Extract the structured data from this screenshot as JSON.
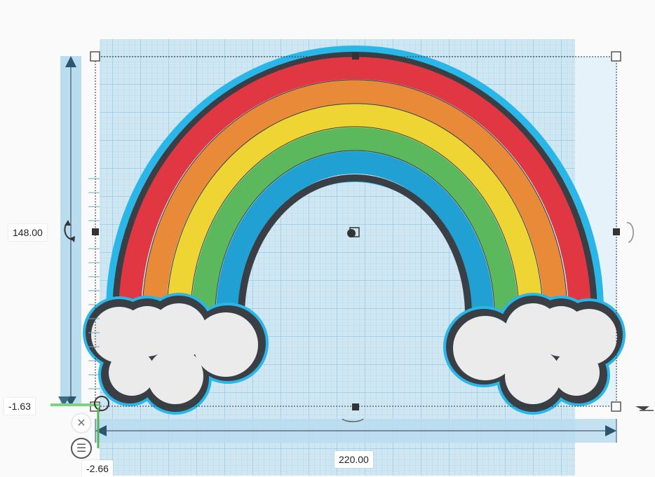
{
  "dimensions": {
    "height": "148.00",
    "width": "220.00",
    "elevation": "-1.63",
    "depth": "-2.66"
  },
  "controls": {
    "close_icon": "close-icon",
    "menu_icon": "menu-lines-icon",
    "close_glyph": "✕",
    "menu_glyph": "☰"
  },
  "colors": {
    "grid_fill": "#cfe6f3",
    "selection": "#29b6e8",
    "outline": "#3a3f45",
    "red": "#e03742",
    "orange": "#e98a38",
    "yellow": "#efd533",
    "green": "#5cb85c",
    "blue": "#21a1d3",
    "cloud": "#ebebeb"
  }
}
